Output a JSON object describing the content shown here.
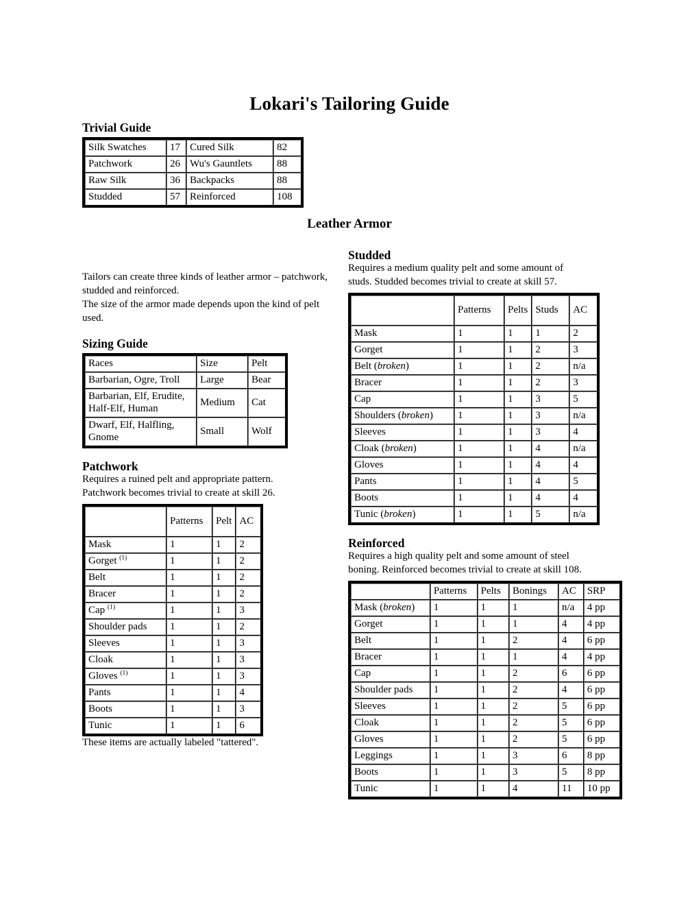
{
  "document": {
    "title": "Lokari's Tailoring Guide",
    "leather_armor_heading": "Leather Armor"
  },
  "trivial_guide": {
    "heading": "Trivial Guide",
    "rows": [
      {
        "name_a": "Silk Swatches",
        "skill_a": "17",
        "name_b": "Cured Silk",
        "skill_b": "82"
      },
      {
        "name_a": "Patchwork",
        "skill_a": "26",
        "name_b": "Wu's Gauntlets",
        "skill_b": "88"
      },
      {
        "name_a": "Raw Silk",
        "skill_a": "36",
        "name_b": "Backpacks",
        "skill_b": "88"
      },
      {
        "name_a": "Studded",
        "skill_a": "57",
        "name_b": "Reinforced",
        "skill_b": "108"
      }
    ]
  },
  "intro": {
    "line1": "Tailors can create three kinds of leather armor – patchwork, studded and reinforced.",
    "line2": "The size of the armor made depends upon the kind of pelt used."
  },
  "sizing_guide": {
    "heading": "Sizing Guide",
    "headers": {
      "races": "Races",
      "size": "Size",
      "pelt": "Pelt"
    },
    "rows": [
      {
        "races": "Barbarian, Ogre, Troll",
        "size": "Large",
        "pelt": "Bear"
      },
      {
        "races": "Barbarian, Elf, Erudite, Half-Elf, Human",
        "size": "Medium",
        "pelt": "Cat"
      },
      {
        "races": "Dwarf, Elf, Halfling, Gnome",
        "size": "Small",
        "pelt": "Wolf"
      }
    ]
  },
  "patchwork": {
    "heading": "Patchwork",
    "description_line1": "Requires a ruined pelt and appropriate pattern.",
    "description_line2": "Patchwork becomes trivial to create at skill 26.",
    "headers": {
      "item": "",
      "patterns": "Patterns",
      "pelt": "Pelt",
      "ac": "AC"
    },
    "rows": [
      {
        "item": "Mask",
        "footnote": "",
        "patterns": "1",
        "pelt": "1",
        "ac": "2"
      },
      {
        "item": "Gorget",
        "footnote": "(1)",
        "patterns": "1",
        "pelt": "1",
        "ac": "2"
      },
      {
        "item": "Belt",
        "footnote": "",
        "patterns": "1",
        "pelt": "1",
        "ac": "2"
      },
      {
        "item": "Bracer",
        "footnote": "",
        "patterns": "1",
        "pelt": "1",
        "ac": "2"
      },
      {
        "item": "Cap",
        "footnote": "(1)",
        "patterns": "1",
        "pelt": "1",
        "ac": "3"
      },
      {
        "item": "Shoulder pads",
        "footnote": "",
        "patterns": "1",
        "pelt": "1",
        "ac": "2"
      },
      {
        "item": "Sleeves",
        "footnote": "",
        "patterns": "1",
        "pelt": "1",
        "ac": "3"
      },
      {
        "item": "Cloak",
        "footnote": "",
        "patterns": "1",
        "pelt": "1",
        "ac": "3"
      },
      {
        "item": "Gloves",
        "footnote": "(1)",
        "patterns": "1",
        "pelt": "1",
        "ac": "3"
      },
      {
        "item": "Pants",
        "footnote": "",
        "patterns": "1",
        "pelt": "1",
        "ac": "4"
      },
      {
        "item": "Boots",
        "footnote": "",
        "patterns": "1",
        "pelt": "1",
        "ac": "3"
      },
      {
        "item": "Tunic",
        "footnote": "",
        "patterns": "1",
        "pelt": "1",
        "ac": "6"
      }
    ],
    "footnote_text": "These items are actually labeled \"tattered\"."
  },
  "studded": {
    "heading": "Studded",
    "description_line1": "Requires a medium quality pelt and some amount of",
    "description_line2": "studs. Studded becomes trivial to create at skill 57.",
    "headers": {
      "item": "",
      "patterns": "Patterns",
      "pelts": "Pelts",
      "studs": "Studs",
      "ac": "AC"
    },
    "rows": [
      {
        "item": "Mask",
        "note": "",
        "patterns": "1",
        "pelts": "1",
        "studs": "1",
        "ac": "2"
      },
      {
        "item": "Gorget",
        "note": "",
        "patterns": "1",
        "pelts": "1",
        "studs": "2",
        "ac": "3"
      },
      {
        "item": "Belt",
        "note": "broken",
        "patterns": "1",
        "pelts": "1",
        "studs": "2",
        "ac": "n/a"
      },
      {
        "item": "Bracer",
        "note": "",
        "patterns": "1",
        "pelts": "1",
        "studs": "2",
        "ac": "3"
      },
      {
        "item": "Cap",
        "note": "",
        "patterns": "1",
        "pelts": "1",
        "studs": "3",
        "ac": "5"
      },
      {
        "item": "Shoulders",
        "note": "broken",
        "patterns": "1",
        "pelts": "1",
        "studs": "3",
        "ac": "n/a"
      },
      {
        "item": "Sleeves",
        "note": "",
        "patterns": "1",
        "pelts": "1",
        "studs": "3",
        "ac": "4"
      },
      {
        "item": "Cloak",
        "note": "broken",
        "patterns": "1",
        "pelts": "1",
        "studs": "4",
        "ac": "n/a"
      },
      {
        "item": "Gloves",
        "note": "",
        "patterns": "1",
        "pelts": "1",
        "studs": "4",
        "ac": "4"
      },
      {
        "item": "Pants",
        "note": "",
        "patterns": "1",
        "pelts": "1",
        "studs": "4",
        "ac": "5"
      },
      {
        "item": "Boots",
        "note": "",
        "patterns": "1",
        "pelts": "1",
        "studs": "4",
        "ac": "4"
      },
      {
        "item": "Tunic",
        "note": "broken",
        "patterns": "1",
        "pelts": "1",
        "studs": "5",
        "ac": "n/a"
      }
    ]
  },
  "reinforced": {
    "heading": "Reinforced",
    "description_line1": "Requires a high quality pelt and some amount of steel",
    "description_line2": "boning. Reinforced becomes trivial to create at skill 108.",
    "headers": {
      "item": "",
      "patterns": "Patterns",
      "pelts": "Pelts",
      "bonings": "Bonings",
      "ac": "AC",
      "srp": "SRP"
    },
    "rows": [
      {
        "item": "Mask",
        "note": "broken",
        "patterns": "1",
        "pelts": "1",
        "bonings": "1",
        "ac": "n/a",
        "srp": "4 pp"
      },
      {
        "item": "Gorget",
        "note": "",
        "patterns": "1",
        "pelts": "1",
        "bonings": "1",
        "ac": "4",
        "srp": "4 pp"
      },
      {
        "item": "Belt",
        "note": "",
        "patterns": "1",
        "pelts": "1",
        "bonings": "2",
        "ac": "4",
        "srp": "6 pp"
      },
      {
        "item": "Bracer",
        "note": "",
        "patterns": "1",
        "pelts": "1",
        "bonings": "1",
        "ac": "4",
        "srp": "4 pp"
      },
      {
        "item": "Cap",
        "note": "",
        "patterns": "1",
        "pelts": "1",
        "bonings": "2",
        "ac": "6",
        "srp": "6 pp"
      },
      {
        "item": "Shoulder pads",
        "note": "",
        "patterns": "1",
        "pelts": "1",
        "bonings": "2",
        "ac": "4",
        "srp": "6 pp"
      },
      {
        "item": "Sleeves",
        "note": "",
        "patterns": "1",
        "pelts": "1",
        "bonings": "2",
        "ac": "5",
        "srp": "6 pp"
      },
      {
        "item": "Cloak",
        "note": "",
        "patterns": "1",
        "pelts": "1",
        "bonings": "2",
        "ac": "5",
        "srp": "6 pp"
      },
      {
        "item": "Gloves",
        "note": "",
        "patterns": "1",
        "pelts": "1",
        "bonings": "2",
        "ac": "5",
        "srp": "6 pp"
      },
      {
        "item": "Leggings",
        "note": "",
        "patterns": "1",
        "pelts": "1",
        "bonings": "3",
        "ac": "6",
        "srp": "8 pp"
      },
      {
        "item": "Boots",
        "note": "",
        "patterns": "1",
        "pelts": "1",
        "bonings": "3",
        "ac": "5",
        "srp": "8 pp"
      },
      {
        "item": "Tunic",
        "note": "",
        "patterns": "1",
        "pelts": "1",
        "bonings": "4",
        "ac": "11",
        "srp": "10 pp"
      }
    ]
  }
}
